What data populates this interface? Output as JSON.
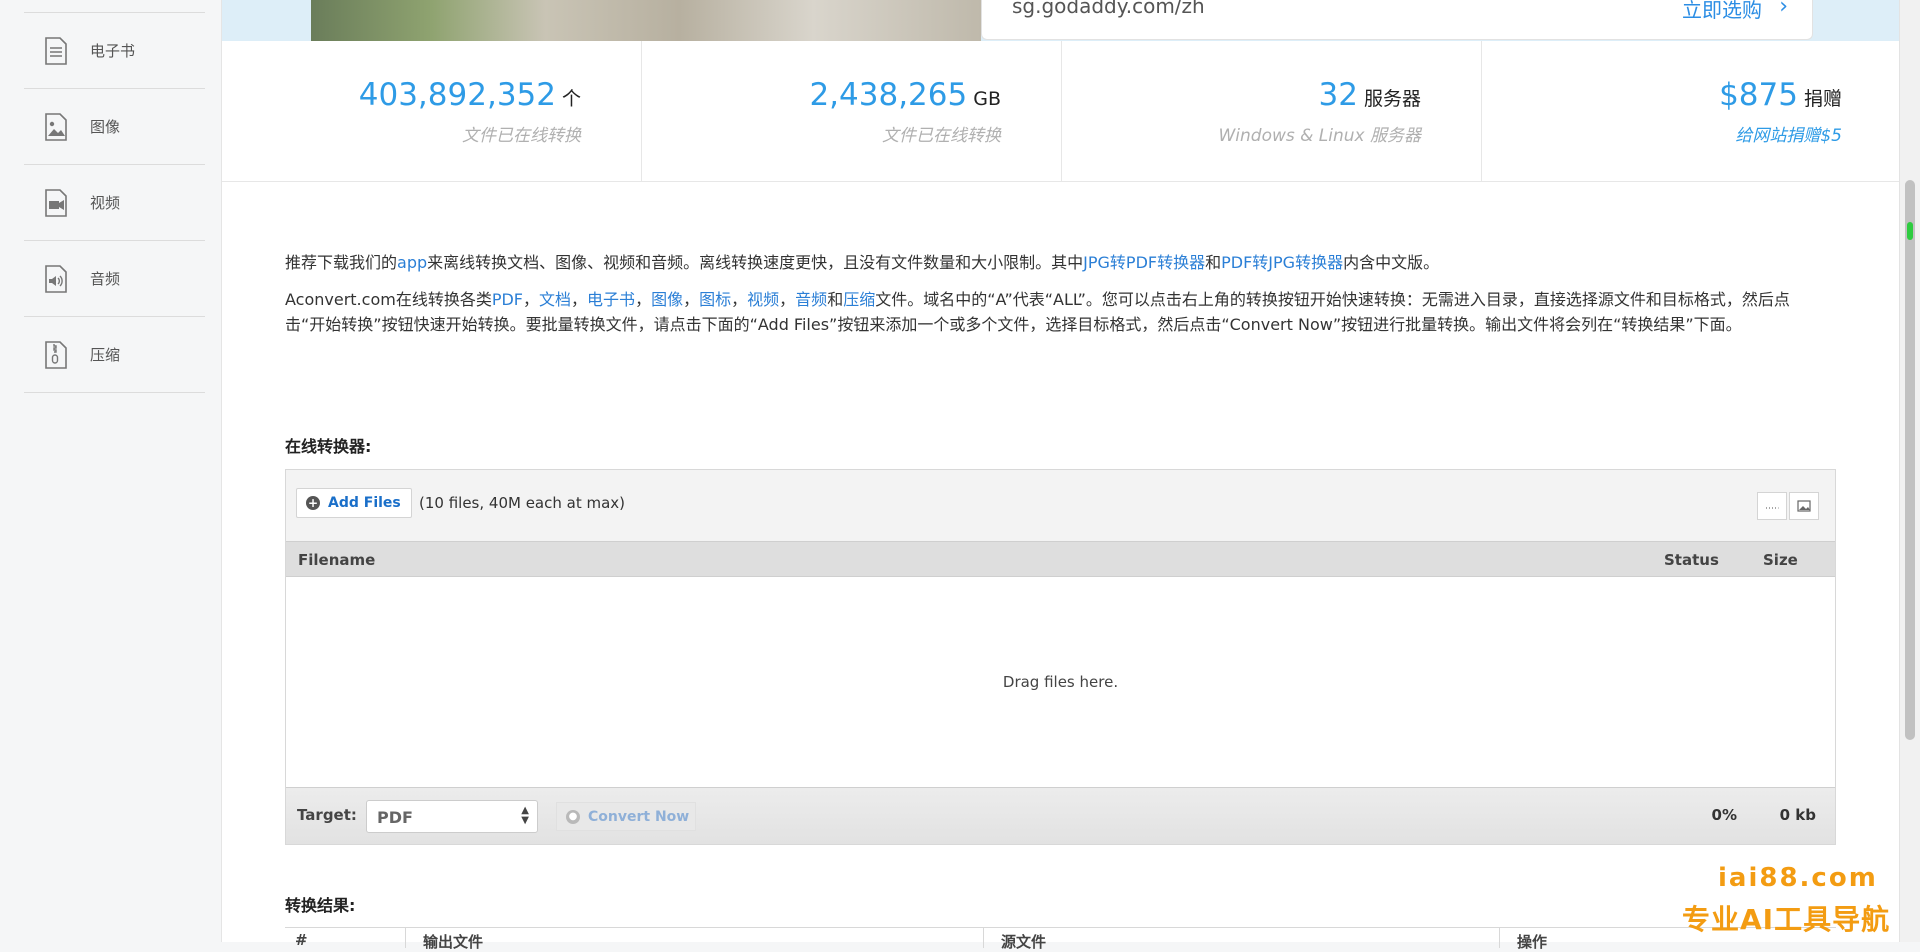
{
  "sidebar": {
    "items": [
      {
        "label": "电子书",
        "icon": "ebook-icon"
      },
      {
        "label": "图像",
        "icon": "image-icon"
      },
      {
        "label": "视频",
        "icon": "video-icon"
      },
      {
        "label": "音频",
        "icon": "audio-icon"
      },
      {
        "label": "压缩",
        "icon": "archive-icon"
      }
    ]
  },
  "banner": {
    "url": "sg.godaddy.com/zh",
    "cta": "立即选购",
    "arrow": "›"
  },
  "stats": [
    {
      "num": "403,892,352",
      "unit": "个",
      "desc": "文件已在线转换"
    },
    {
      "num": "2,438,265",
      "unit": "GB",
      "desc": "文件已在线转换"
    },
    {
      "num": "32",
      "unit": "服务器",
      "desc": "Windows & Linux 服务器"
    },
    {
      "num": "$875",
      "unit": "捐赠",
      "desc": "给网站捐赠$5"
    }
  ],
  "intro": {
    "p1": {
      "t1": "推荐下载我们的",
      "l1": "app",
      "t2": "来离线转换文档、图像、视频和音频。离线转换速度更快，且没有文件数量和大小限制。其中",
      "l2": "JPG转PDF转换器",
      "t3": "和",
      "l3": "PDF转JPG转换器",
      "t4": "内含中文版。"
    },
    "p2": {
      "t1": "Aconvert.com在线转换各类",
      "l_pdf": "PDF",
      "sep1": "，",
      "l_doc": "文档",
      "sep2": "，",
      "l_ebook": "电子书",
      "sep3": "，",
      "l_image": "图像",
      "sep4": "，",
      "l_icon": "图标",
      "sep5": "，",
      "l_video": "视频",
      "sep6": "，",
      "l_audio": "音频",
      "and": "和",
      "l_archive": "压缩",
      "t2": "文件。域名中的“A”代表“ALL”。您可以点击右上角的转换按钮开始快速转换：无需进入目录，直接选择源文件和目标格式，然后点击“开始转换”按钮快速开始转换。要批量转换文件，请点击下面的“Add Files”按钮来添加一个或多个文件，选择目标格式，然后点击“Convert Now”按钮进行批量转换。输出文件将会列在“转换结果”下面。"
    }
  },
  "converter": {
    "title": "在线转换器:",
    "add_files": "Add Files",
    "add_icon": "+",
    "limit": "(10 files, 40M each at max)",
    "columns": {
      "filename": "Filename",
      "status": "Status",
      "size": "Size"
    },
    "drop_text": "Drag files here.",
    "target_label": "Target:",
    "target_value": "PDF",
    "convert_now": "Convert Now",
    "progress": "0%",
    "size_total": "0 kb"
  },
  "results": {
    "title": "转换结果:",
    "columns": [
      "#",
      "输出文件",
      "源文件",
      "操作"
    ]
  },
  "watermark": {
    "line1": "iai88.com",
    "line2": "专业AI工具导航"
  },
  "colors": {
    "accent": "#2e9be6",
    "link": "#2b7fd6",
    "watermark": "#f39c12"
  }
}
